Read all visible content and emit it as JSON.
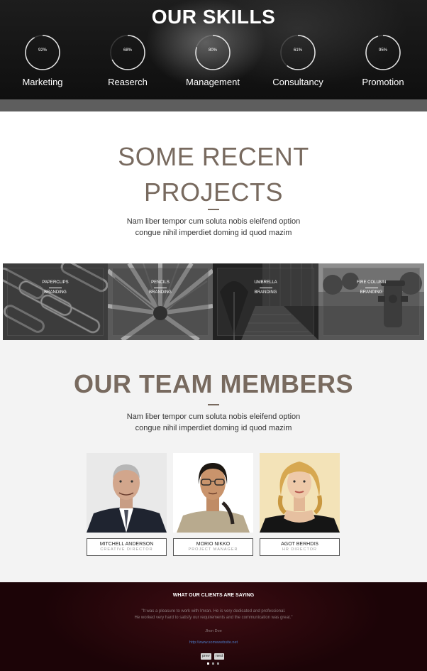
{
  "skills": {
    "title": "OUR SKILLS",
    "items": [
      {
        "label": "Marketing",
        "percent_text": "92%",
        "value": 92
      },
      {
        "label": "Reaserch",
        "percent_text": "68%",
        "value": 68
      },
      {
        "label": "Management",
        "percent_text": "80%",
        "value": 80
      },
      {
        "label": "Consultancy",
        "percent_text": "61%",
        "value": 61
      },
      {
        "label": "Promotion",
        "percent_text": "95%",
        "value": 95
      }
    ]
  },
  "projects": {
    "title_line1": "SOME RECENT",
    "title_line2": "PROJECTS",
    "lead_line1": "Nam liber tempor cum soluta nobis eleifend option",
    "lead_line2": "congue nihil imperdiet doming id quod mazim",
    "items": [
      {
        "title": "PAPERCLIPS",
        "category": "BRANDING"
      },
      {
        "title": "PENCILS",
        "category": "BRANDING"
      },
      {
        "title": "UMBRELLA",
        "category": "BRANDING"
      },
      {
        "title": "FIRE COLUMN",
        "category": "BRANDING"
      }
    ]
  },
  "team": {
    "title": "OUR TEAM MEMBERS",
    "lead_line1": "Nam liber tempor cum soluta nobis eleifend option",
    "lead_line2": "congue nihil imperdiet doming id quod mazim",
    "members": [
      {
        "name": "MITCHELL ANDERSON",
        "role": "CREATIVE DIRECTOR"
      },
      {
        "name": "MORIO NIKKO",
        "role": "PROJECT MANAGER"
      },
      {
        "name": "AGOT BERHDIS",
        "role": "HR DIRECTOR"
      }
    ]
  },
  "clients": {
    "title": "WHAT OUR CLIENTS ARE SAYING",
    "quote_line1": "\"It was a pleasure to work with Imran. He is very dedicated and professional.",
    "quote_line2": "He worked very hard to satisfy our requirements and the communication was great.\"",
    "author": "Jhon Doe",
    "site": "http://www.somewebsite.net",
    "prev_label": "prev",
    "next_label": "next"
  },
  "colors": {
    "heading": "#786a5f",
    "ring": "#e6e6e6",
    "testimonial_bg": "#2a080c",
    "link": "#4a78c2"
  }
}
